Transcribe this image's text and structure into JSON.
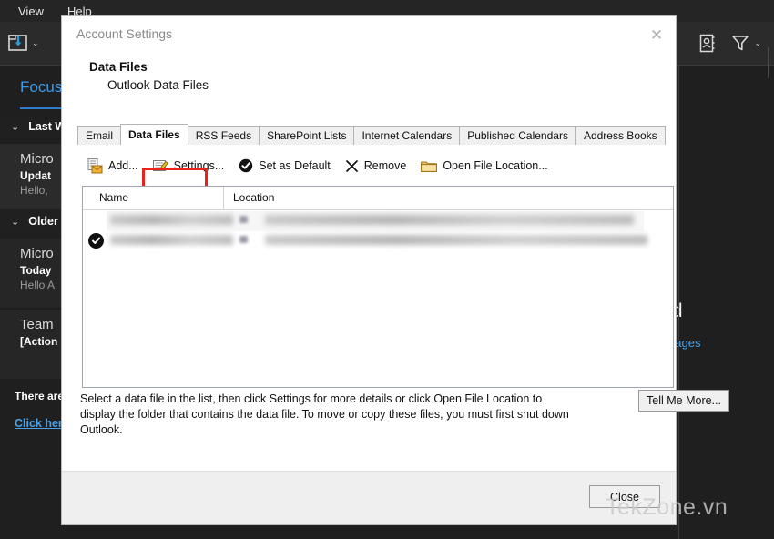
{
  "outlook": {
    "menubar": [
      {
        "label": "View",
        "name": "menu-view"
      },
      {
        "label": "Help",
        "name": "menu-help"
      }
    ],
    "ribbon": {
      "move_icon": "move-to-folder-icon",
      "dropdown_caret": "⌄",
      "address_book_icon": "address-book-icon",
      "filter_icon": "filter-icon"
    },
    "mail_list": {
      "pivot_label": "Focus",
      "groups": [
        {
          "caret": "⌄",
          "label": "Last W"
        },
        {
          "caret": "⌄",
          "label": "Older"
        }
      ],
      "messages": [
        {
          "from": "Micro",
          "subject": "Updat",
          "preview": "Hello,"
        },
        {
          "from": "Micro",
          "subject": "Today",
          "preview": "Hello A"
        },
        {
          "from": "Team",
          "subject": "[Action",
          "preview": ""
        }
      ],
      "footer_note": "There are",
      "footer_link": "Click her"
    },
    "reading_pane": {
      "headline": "o read",
      "link": "ew messages"
    }
  },
  "dialog": {
    "title": "Account Settings",
    "close_icon": "✕",
    "heading": "Data Files",
    "subheading": "Outlook Data Files",
    "tabs": [
      {
        "label": "Email",
        "active": false,
        "name": "tab-email"
      },
      {
        "label": "Data Files",
        "active": true,
        "name": "tab-data-files"
      },
      {
        "label": "RSS Feeds",
        "active": false,
        "name": "tab-rss-feeds"
      },
      {
        "label": "SharePoint Lists",
        "active": false,
        "name": "tab-sharepoint-lists"
      },
      {
        "label": "Internet Calendars",
        "active": false,
        "name": "tab-internet-calendars"
      },
      {
        "label": "Published Calendars",
        "active": false,
        "name": "tab-published-calendars"
      },
      {
        "label": "Address Books",
        "active": false,
        "name": "tab-address-books"
      }
    ],
    "toolbar": [
      {
        "label": "Add...",
        "icon": "add-data-file-icon",
        "name": "add-button",
        "highlighted": true
      },
      {
        "label": "Settings...",
        "icon": "settings-icon",
        "name": "settings-button",
        "highlighted": false
      },
      {
        "label": "Set as Default",
        "icon": "check-circle-icon",
        "name": "set-as-default-button",
        "highlighted": false
      },
      {
        "label": "Remove",
        "icon": "x-icon",
        "name": "remove-button",
        "highlighted": false
      },
      {
        "label": "Open File Location...",
        "icon": "folder-icon",
        "name": "open-file-location-button",
        "highlighted": false
      }
    ],
    "list": {
      "columns": [
        "Name",
        "Location"
      ],
      "rows": [
        {
          "default": false,
          "name": "",
          "location": "",
          "redacted": true,
          "selected": true
        },
        {
          "default": true,
          "name": "",
          "location": "",
          "redacted": true,
          "selected": false
        }
      ],
      "default_marker_icon": "check-circle-icon"
    },
    "description": "Select a data file in the list, then click Settings for more details or click Open File Location to display the folder that contains the data file. To move or copy these files, you must first shut down Outlook.",
    "tell_me_more_label": "Tell Me More...",
    "close_label": "Close"
  },
  "watermark": {
    "text": "TekZone.vn"
  },
  "colors": {
    "app_background": "#1f1f1f",
    "dialog_background": "#ffffff",
    "accent_blue": "#3d9ae8",
    "highlight_red": "#e8231a",
    "footer_gray": "#efefef"
  }
}
